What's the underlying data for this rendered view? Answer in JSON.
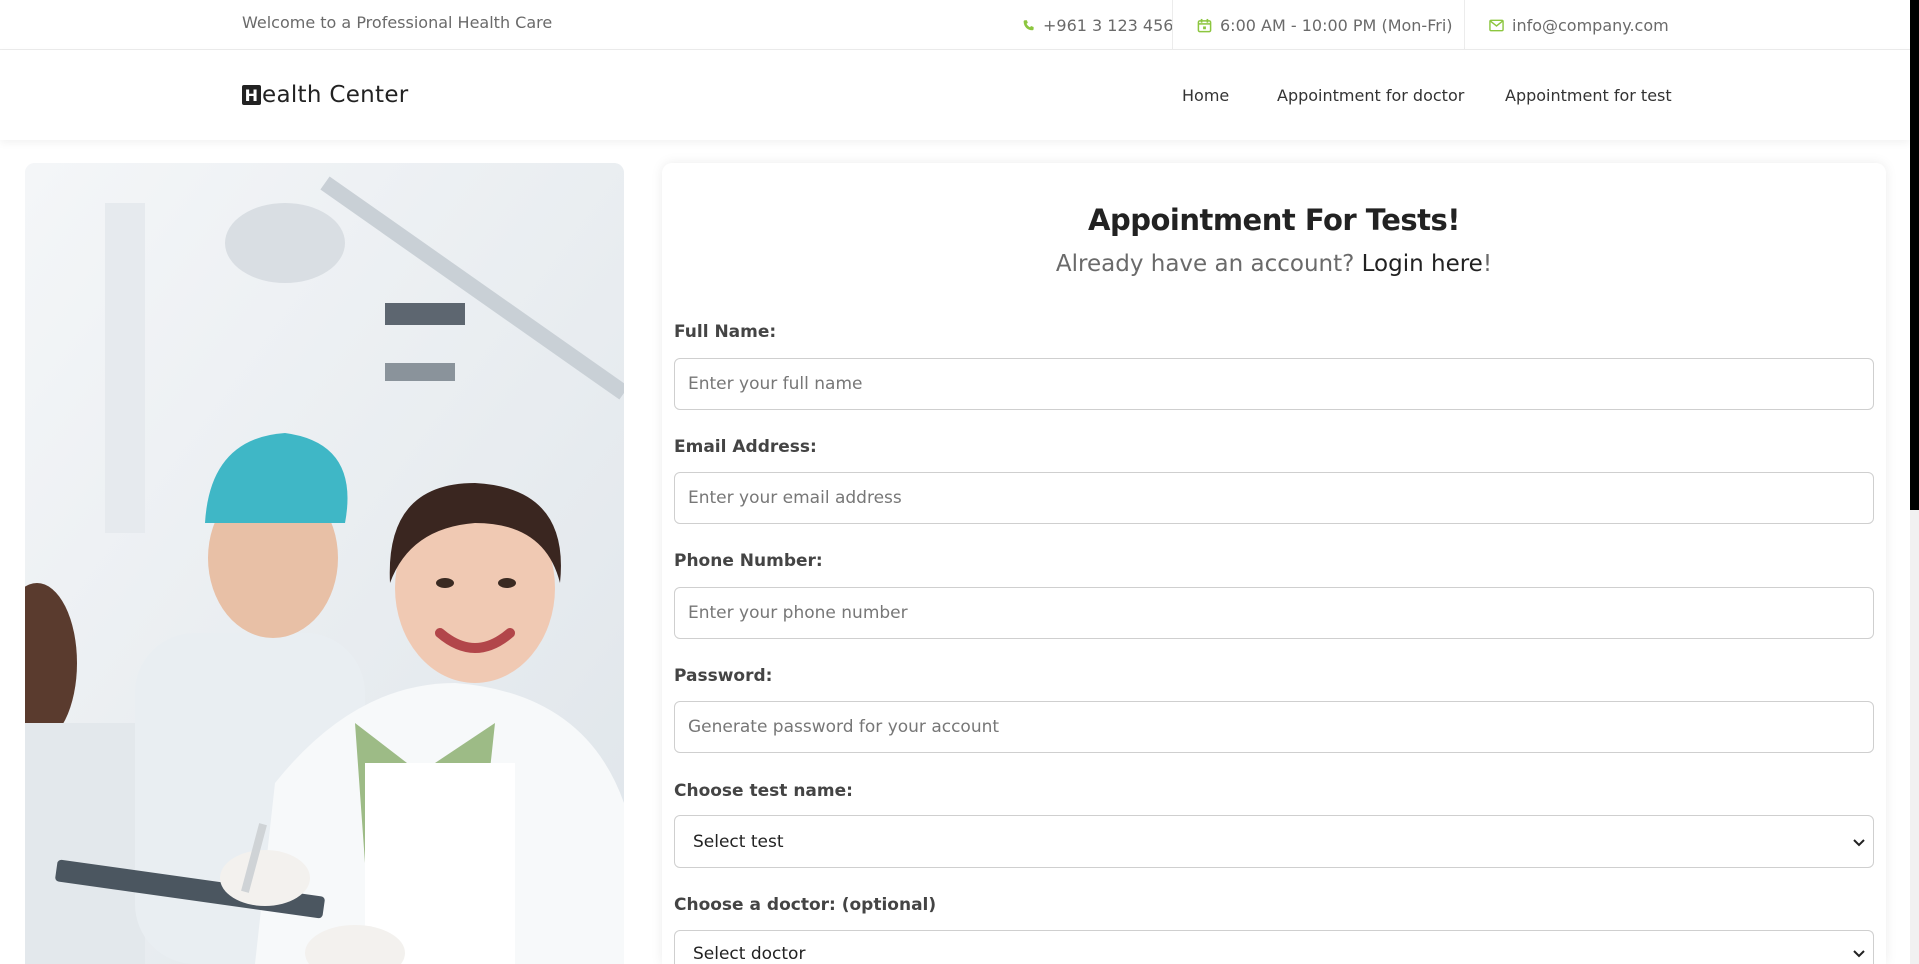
{
  "topbar": {
    "welcome": "Welcome to a Professional Health Care",
    "phone": "+961 3 123 456",
    "hours": "6:00 AM - 10:00 PM (Mon-Fri)",
    "email": "info@company.com"
  },
  "header": {
    "logo_initial": "H",
    "logo_rest": "ealth Center",
    "nav": [
      {
        "label": "Home"
      },
      {
        "label": "Appointment for doctor"
      },
      {
        "label": "Appointment for test"
      }
    ]
  },
  "form": {
    "title": "Appointment For Tests!",
    "subtitle_prefix": "Already have an account? ",
    "login_link": "Login here",
    "subtitle_suffix": "!",
    "full_name": {
      "label": "Full Name:",
      "placeholder": "Enter your full name"
    },
    "email": {
      "label": "Email Address:",
      "placeholder": "Enter your email address"
    },
    "phone": {
      "label": "Phone Number:",
      "placeholder": "Enter your phone number"
    },
    "password": {
      "label": "Password:",
      "placeholder": "Generate password for your account"
    },
    "test": {
      "label": "Choose test name:",
      "selected": "Select test"
    },
    "doctor": {
      "label": "Choose a doctor: (optional)",
      "selected": "Select doctor"
    }
  },
  "colors": {
    "accent": "#8cc63f",
    "text_dark": "#222222",
    "text_muted": "#6a6a6a"
  }
}
